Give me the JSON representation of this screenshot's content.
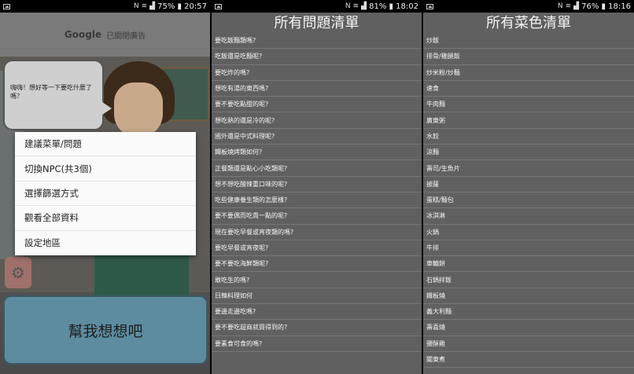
{
  "panel1": {
    "status": {
      "right_text": "75% ▮ 20:57"
    },
    "ad": {
      "brand": "Google",
      "text": "已關閉廣告"
    },
    "bubble_text": "嗨嗨！想好等一下要吃什麼了嗎？",
    "menu": [
      "建議菜單/問題",
      "切換NPC(共3個)",
      "選擇篩選方式",
      "觀看全部資料",
      "設定地區"
    ],
    "big_button": "幫我想想吧"
  },
  "panel2": {
    "status": {
      "right_text": "81% ▮ 18:02"
    },
    "title": "所有問題清單",
    "items": [
      "要吃飯麵類嗎?",
      "吃飯還是吃麵呢?",
      "要吃炸的嗎?",
      "想吃有湯的東西嗎?",
      "要不要吃點甜的呢?",
      "想吃熱的還是冷的呢?",
      "國外還是中式料理呢?",
      "鐵板燒烤類如何?",
      "正餐類還是點心小吃類呢?",
      "想不想吃酸辣重口味的呢?",
      "吃些健康養生類的怎麼樣?",
      "要不要偶而吃貴一點的呢?",
      "現在要吃早餐或宵夜類的嗎?",
      "要吃早餐或宵夜呢?",
      "要不要吃海鮮類呢?",
      "敢吃生的嗎?",
      "日韓料理如何",
      "要邊走邊吃嗎?",
      "要不要吃超商就買得到的?",
      "要素食可食的嗎?"
    ]
  },
  "panel3": {
    "status": {
      "right_text": "76% ▮ 18:16"
    },
    "title": "所有菜色清單",
    "items": [
      "炒飯",
      "排骨/雞腿飯",
      "炒米粉/炒麵",
      "速食",
      "牛肉麵",
      "廣東粥",
      "水餃",
      "涼麵",
      "壽司/生魚片",
      "披薩",
      "蛋糕/麵包",
      "冰淇淋",
      "火鍋",
      "牛排",
      "車輪餅",
      "石鍋拌飯",
      "鐵板燒",
      "義大利麵",
      "壽喜燒",
      "鹽酥雞",
      "關東煮"
    ]
  }
}
